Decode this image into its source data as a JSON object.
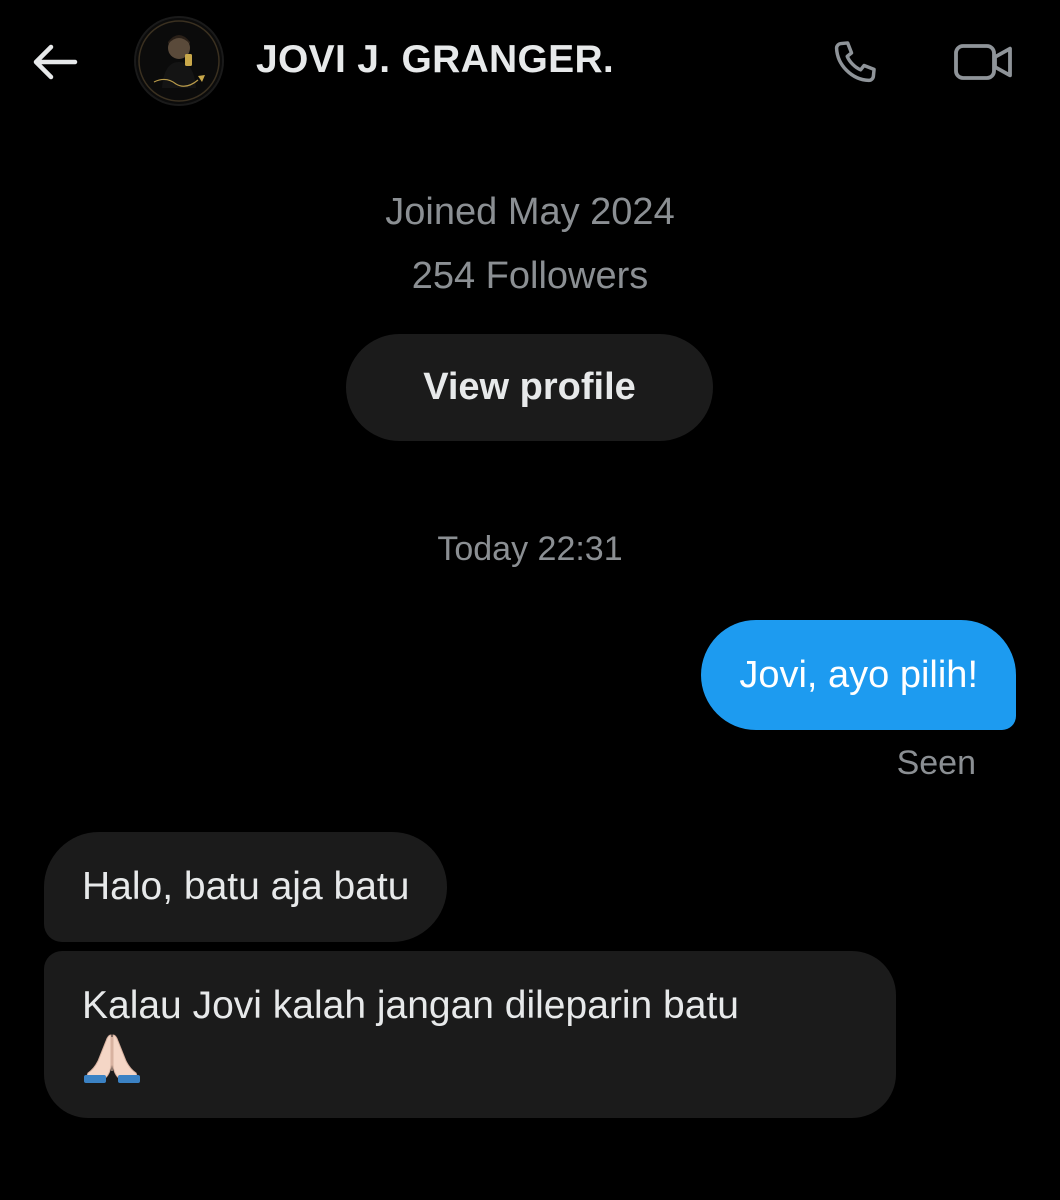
{
  "header": {
    "title": "JOVI J. GRANGER.",
    "back_icon": "back-arrow-icon",
    "call_icon": "phone-icon",
    "video_icon": "video-camera-icon"
  },
  "profile": {
    "joined": "Joined May 2024",
    "followers": "254 Followers",
    "view_profile_label": "View profile"
  },
  "conversation": {
    "timestamp": "Today 22:31",
    "messages": [
      {
        "direction": "outgoing",
        "text": "Jovi, ayo pilih!"
      },
      {
        "direction": "incoming",
        "text": "Halo, batu aja batu"
      },
      {
        "direction": "incoming",
        "text": "Kalau Jovi kalah jangan dileparin batu",
        "emoji": "folded-hands-icon"
      }
    ],
    "seen_label": "Seen"
  },
  "colors": {
    "background": "#000000",
    "outgoing_bubble": "#1d9bf0",
    "incoming_bubble": "#1b1b1b",
    "muted_text": "#8b8f93",
    "primary_text": "#e7e9ea"
  }
}
